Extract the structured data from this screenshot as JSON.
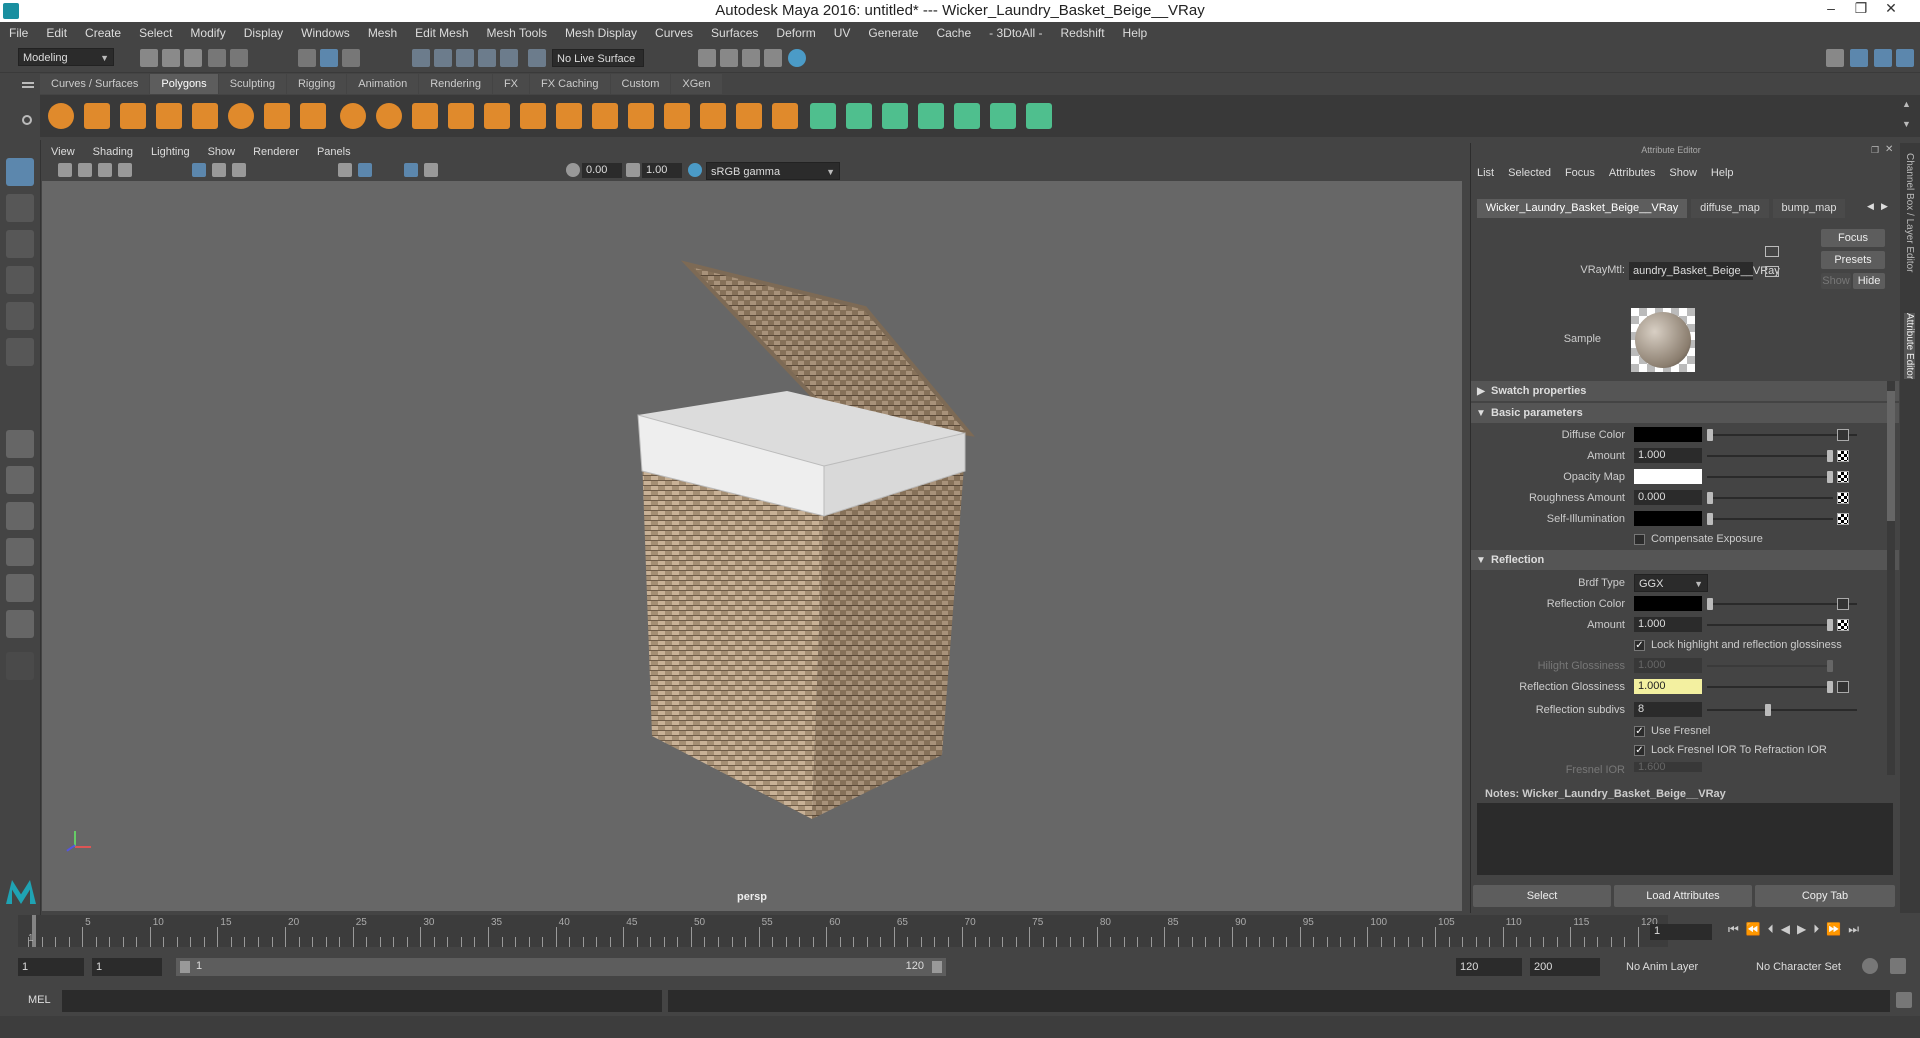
{
  "window": {
    "title": "Autodesk Maya 2016: untitled*   ---   Wicker_Laundry_Basket_Beige__VRay"
  },
  "menubar": [
    "File",
    "Edit",
    "Create",
    "Select",
    "Modify",
    "Display",
    "Windows",
    "Mesh",
    "Edit Mesh",
    "Mesh Tools",
    "Mesh Display",
    "Curves",
    "Surfaces",
    "Deform",
    "UV",
    "Generate",
    "Cache",
    "- 3DtoAll -",
    "Redshift",
    "Help"
  ],
  "status_line": {
    "mode": "Modeling",
    "live_surface": "No Live Surface"
  },
  "shelf_tabs": [
    {
      "label": "Curves / Surfaces",
      "active": false
    },
    {
      "label": "Polygons",
      "active": true
    },
    {
      "label": "Sculpting",
      "active": false
    },
    {
      "label": "Rigging",
      "active": false
    },
    {
      "label": "Animation",
      "active": false
    },
    {
      "label": "Rendering",
      "active": false
    },
    {
      "label": "FX",
      "active": false
    },
    {
      "label": "FX Caching",
      "active": false
    },
    {
      "label": "Custom",
      "active": false
    },
    {
      "label": "XGen",
      "active": false
    }
  ],
  "viewport": {
    "menu": [
      "View",
      "Shading",
      "Lighting",
      "Show",
      "Renderer",
      "Panels"
    ],
    "exposure": "0.00",
    "gamma": "1.00",
    "color_space": "sRGB gamma",
    "camera_label": "persp"
  },
  "attribute_editor": {
    "header": "Attribute Editor",
    "menu": [
      "List",
      "Selected",
      "Focus",
      "Attributes",
      "Show",
      "Help"
    ],
    "tabs": [
      "Wicker_Laundry_Basket_Beige__VRay",
      "diffuse_map",
      "bump_map"
    ],
    "node_type_label": "VRayMtl:",
    "node_name": "aundry_Basket_Beige__VRay",
    "focus_btn": "Focus",
    "presets_btn": "Presets",
    "show_btn": "Show",
    "hide_btn": "Hide",
    "sample_label": "Sample",
    "sections": {
      "swatch": "Swatch properties",
      "basic": "Basic parameters",
      "reflection": "Reflection"
    },
    "basic": {
      "diffuse_color": "Diffuse Color",
      "amount_label": "Amount",
      "amount": "1.000",
      "opacity_map": "Opacity Map",
      "roughness_label": "Roughness Amount",
      "roughness": "0.000",
      "self_illum": "Self-Illumination",
      "compensate": "Compensate Exposure"
    },
    "reflection": {
      "brdf_label": "Brdf Type",
      "brdf": "GGX",
      "refl_color": "Reflection Color",
      "amount_label": "Amount",
      "amount": "1.000",
      "lock_highlight": "Lock highlight and reflection glossiness",
      "hilight_label": "Hilight Glossiness",
      "hilight": "1.000",
      "gloss_label": "Reflection Glossiness",
      "gloss": "1.000",
      "subdivs_label": "Reflection subdivs",
      "subdivs": "8",
      "use_fresnel": "Use Fresnel",
      "lock_fresnel": "Lock Fresnel IOR To Refraction IOR",
      "fresnel_label": "Fresnel IOR",
      "fresnel": "1.600"
    },
    "notes_label": "Notes:  Wicker_Laundry_Basket_Beige__VRay",
    "buttons": [
      "Select",
      "Load Attributes",
      "Copy Tab"
    ],
    "side_tabs": [
      "Channel Box / Layer Editor",
      "Attribute Editor"
    ],
    "colors": {
      "diffuse": "#000000",
      "opacity": "#ffffff",
      "self_illum": "#000000",
      "reflection": "#000000",
      "highlight_field": "#f3f0a0"
    }
  },
  "timeline": {
    "ticks": [
      5,
      10,
      15,
      20,
      25,
      30,
      35,
      40,
      45,
      50,
      55,
      60,
      65,
      70,
      75,
      80,
      85,
      90,
      95,
      100,
      105,
      110,
      115,
      120
    ],
    "start_marker": "1",
    "current_frame": "1"
  },
  "range": {
    "start": "1",
    "playback_start": "1",
    "range_start": "1",
    "range_end": "120",
    "playback_end": "120",
    "end": "200",
    "anim_layer": "No Anim Layer",
    "char_set": "No Character Set"
  },
  "command_line": {
    "label": "MEL"
  }
}
